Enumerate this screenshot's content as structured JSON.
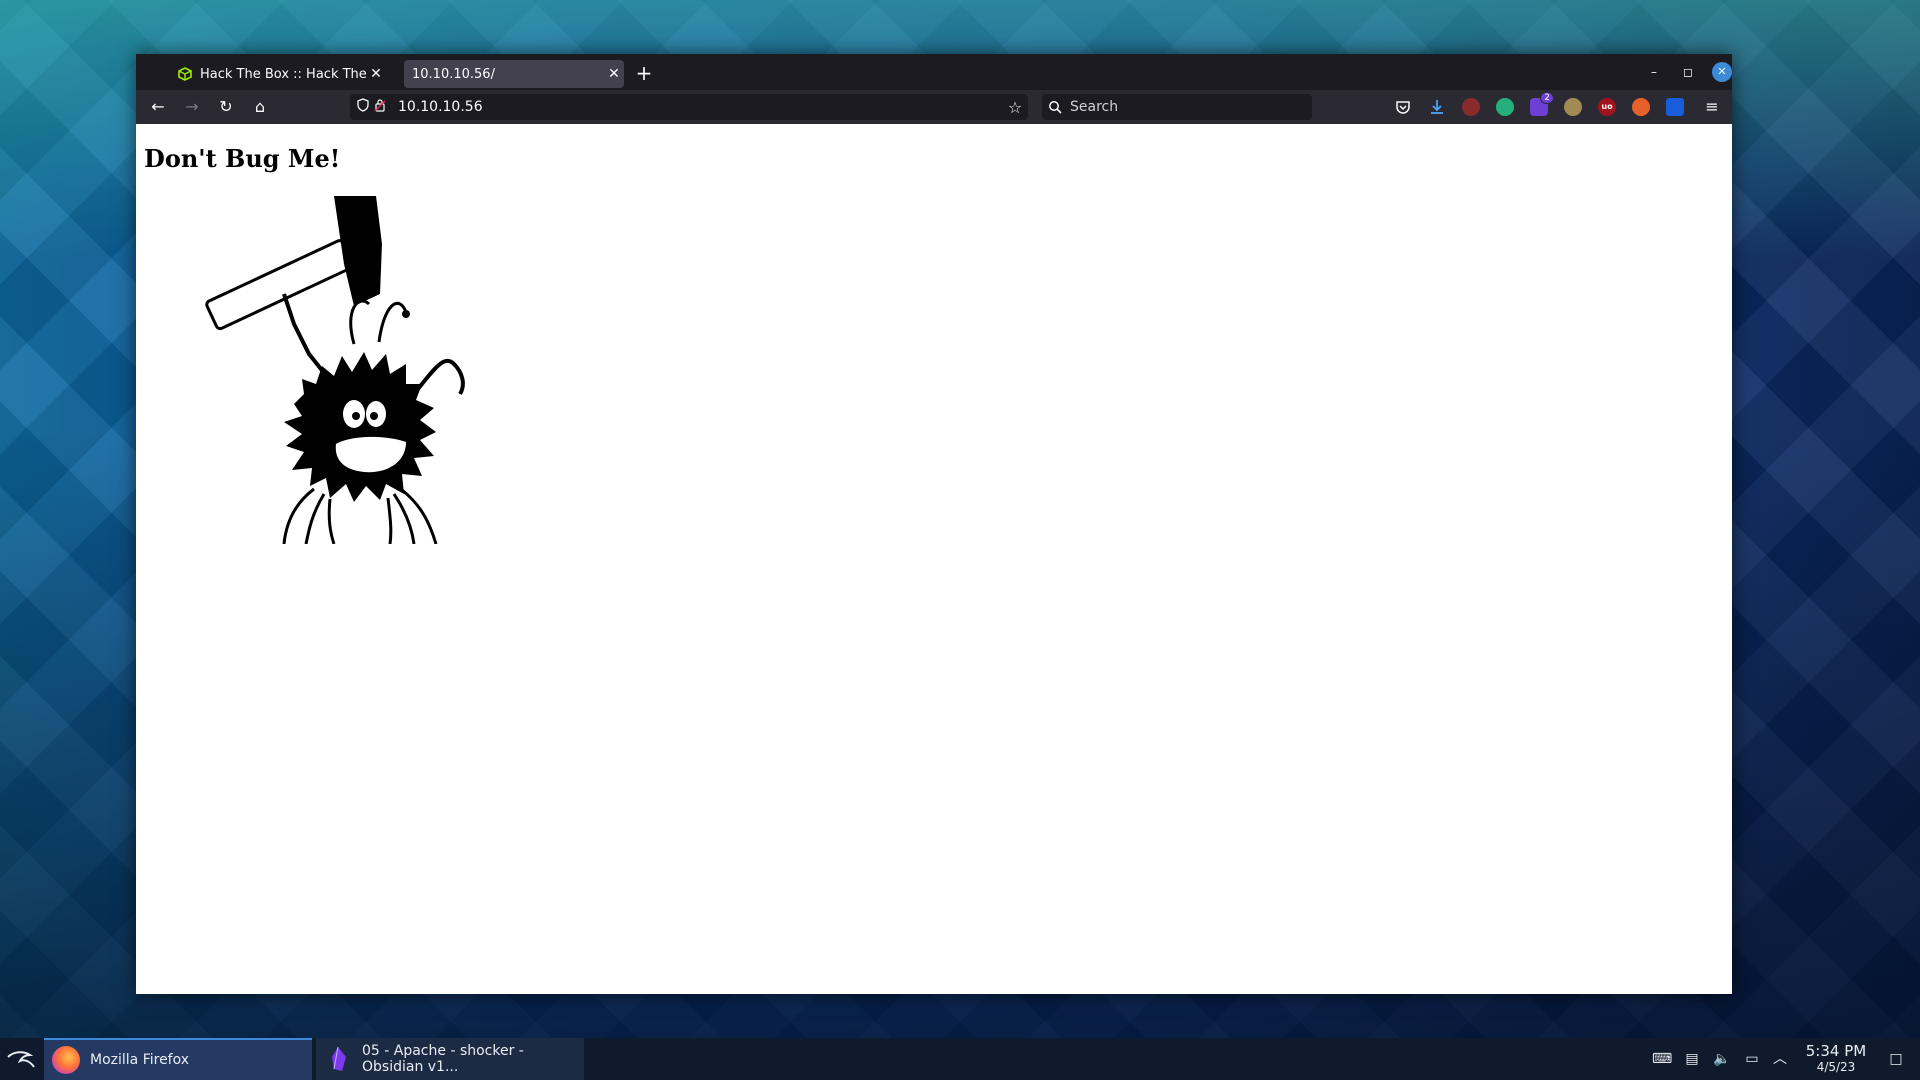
{
  "browser": {
    "tabs": [
      {
        "label": "Hack The Box :: Hack The B",
        "active": false
      },
      {
        "label": "10.10.10.56/",
        "active": true
      }
    ],
    "new_tab_symbol": "+",
    "url": "10.10.10.56",
    "search_placeholder": "Search",
    "extension_badge": "2",
    "ublock_label": "uo"
  },
  "page": {
    "heading": "Don't Bug Me!"
  },
  "taskbar": {
    "tasks": [
      {
        "label": "Mozilla Firefox"
      },
      {
        "label": "05 - Apache - shocker - Obsidian v1..."
      }
    ],
    "clock": {
      "time": "5:34 PM",
      "date": "4/5/23"
    }
  },
  "colors": {
    "tab_bar": "#1c1b22",
    "toolbar": "#2b2a33",
    "active_tab": "#42414d",
    "taskbar": "#0f1a2c",
    "accent": "#3d8bd8"
  }
}
